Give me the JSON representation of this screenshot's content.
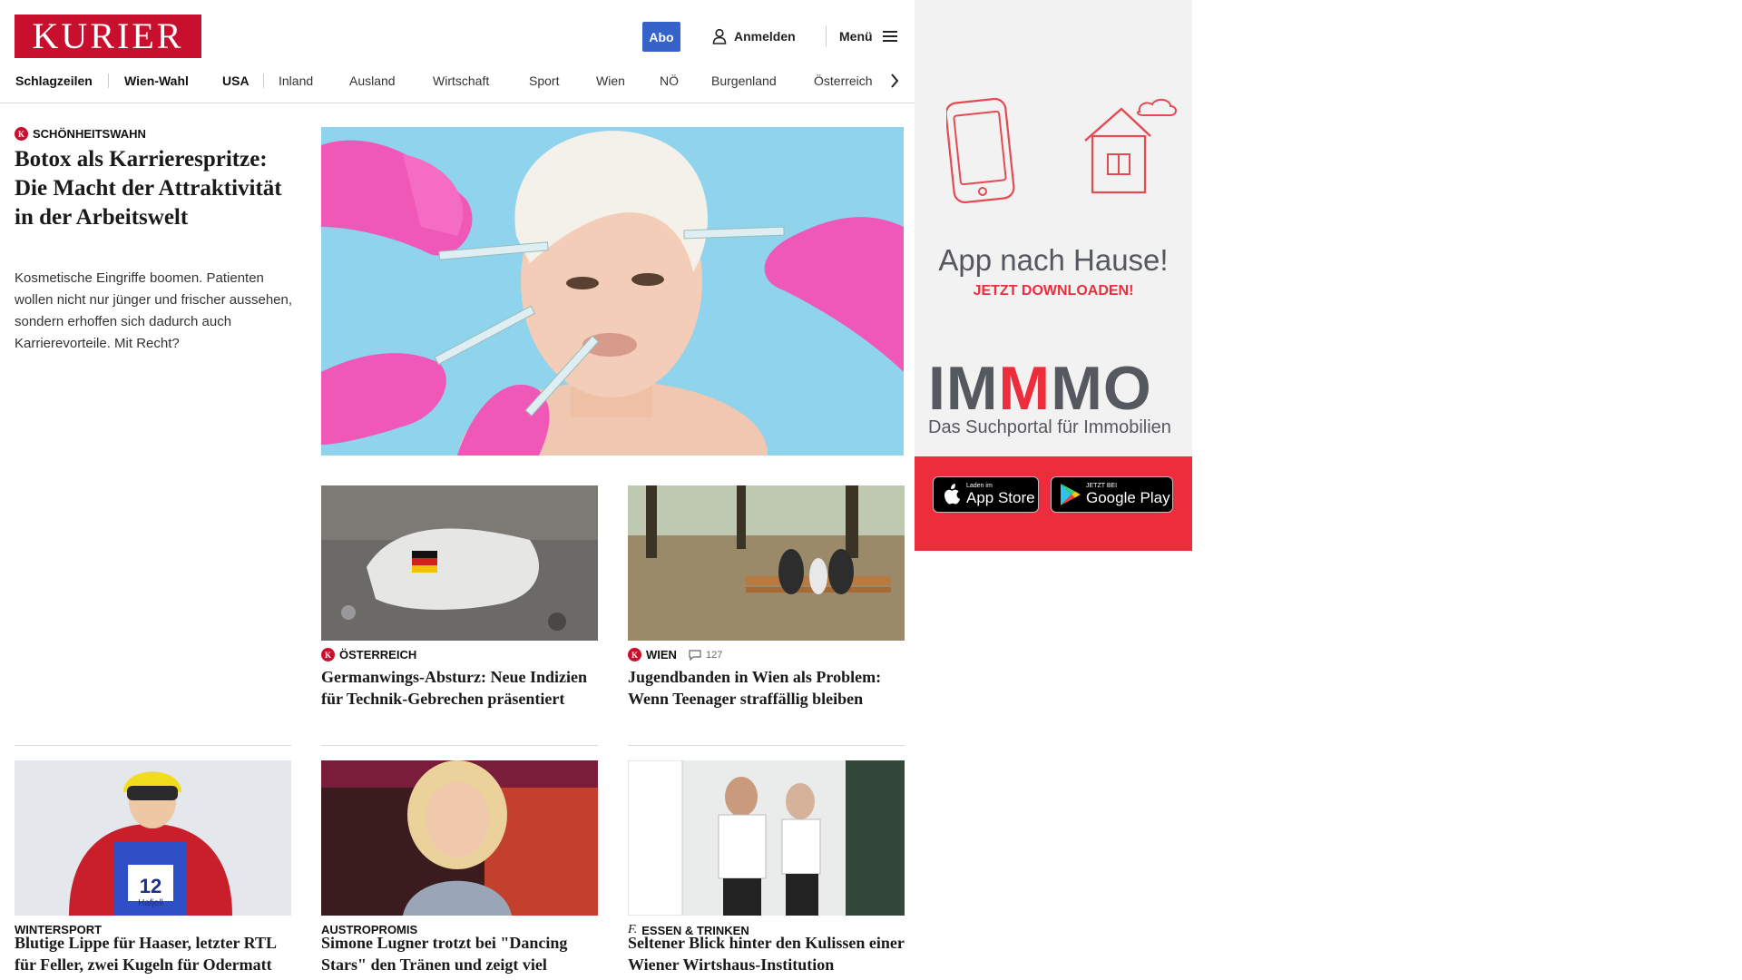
{
  "header": {
    "logo": "KURIER",
    "abo": "Abo",
    "login": "Anmelden",
    "menu": "Menü"
  },
  "nav": {
    "items": [
      "Schlagzeilen",
      "Wien-Wahl",
      "USA",
      "Inland",
      "Ausland",
      "Wirtschaft",
      "Sport",
      "Wien",
      "NÖ",
      "Burgenland",
      "Österreich"
    ]
  },
  "lead": {
    "kicker": "SCHÖNHEITSWAHN",
    "title": "Botox als Karrierespritze: Die Macht der Attraktivität in der Arbeitswelt",
    "teaser": "Kosmetische Eingriffe boomen. Patienten wollen nicht nur jünger und frischer aussehen, sondern erhoffen sich dadurch auch Karrierevorteile. Mit Recht?"
  },
  "cards": [
    {
      "kicker": "ÖSTERREICH",
      "title": "Germanwings-Absturz: Neue Indizien für Technik-Gebrechen präsentiert"
    },
    {
      "kicker": "WIEN",
      "comments": "127",
      "title": "Jugendbanden in Wien als Problem: Wenn Teenager straffällig bleiben"
    },
    {
      "kicker": "WINTERSPORT",
      "title": "Blutige Lippe für Haaser, letzter RTL für Feller, zwei Kugeln für Odermatt"
    },
    {
      "kicker": "AUSTROPROMIS",
      "title": "Simone Lugner trotzt bei \"Dancing Stars\" den Tränen und zeigt viel Potenzial"
    },
    {
      "kicker": "ESSEN & TRINKEN",
      "title": "Seltener Blick hinter den Kulissen einer Wiener Wirtshaus-Institution"
    }
  ],
  "bib_text": {
    "number": "12",
    "name": "Hafjell"
  },
  "ad": {
    "title": "App nach Hause!",
    "subtitle": "JETZT DOWNLOADEN!",
    "brand": "IMMMO",
    "brand_parts": [
      "IM",
      "M",
      "MO"
    ],
    "tagline": "Das Suchportal für Immobilien",
    "appstore_small": "Laden im",
    "appstore_big": "App Store",
    "googleplay_small": "JETZT BEI",
    "googleplay_big": "Google Play"
  },
  "colors": {
    "brand_red": "#c8102e",
    "abo_blue": "#3563c9",
    "ad_red": "#ee2d3c",
    "ad_text_gray": "#55585e"
  }
}
